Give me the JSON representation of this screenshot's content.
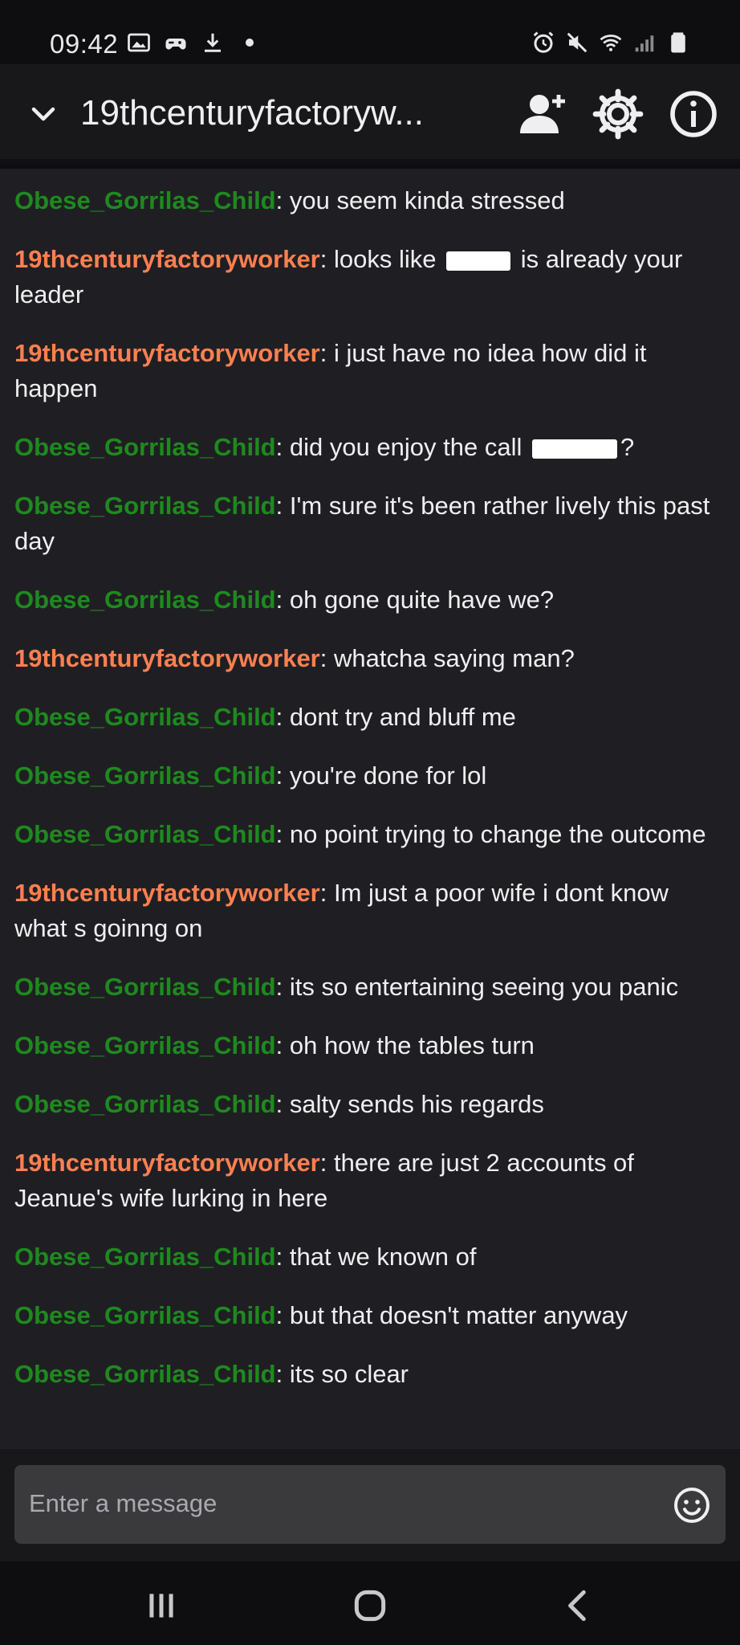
{
  "status_bar": {
    "time": "09:42",
    "left_icons": [
      "image-icon",
      "game-controller-icon",
      "download-icon",
      "dot-icon"
    ],
    "right_icons": [
      "alarm-icon",
      "mute-icon",
      "wifi-icon",
      "signal-icon",
      "battery-icon"
    ]
  },
  "header": {
    "channel_name": "19thcenturyfactoryw...",
    "buttons": [
      "add-user-icon",
      "gear-icon",
      "info-icon"
    ]
  },
  "colors": {
    "user_green": "#1e8a1e",
    "user_orange": "#ff7f50",
    "background": "#1f1f23"
  },
  "messages": [
    {
      "user": "Obese_Gorrilas_Child",
      "text": ": you seem kinda stressed"
    },
    {
      "user": "19thcenturyfactoryworker",
      "text_before": ": looks like ",
      "text_after": " is already your leader",
      "redacted": true
    },
    {
      "user": "19thcenturyfactoryworker",
      "text": ": i just have no idea how did it happen"
    },
    {
      "user": "Obese_Gorrilas_Child",
      "text_before": ": did you enjoy the call ",
      "text_after": "?",
      "redacted": true
    },
    {
      "user": "Obese_Gorrilas_Child",
      "text": ": I'm sure it's been rather lively this past day"
    },
    {
      "user": "Obese_Gorrilas_Child",
      "text": ": oh gone quite have we?"
    },
    {
      "user": "19thcenturyfactoryworker",
      "text": ": whatcha saying man?"
    },
    {
      "user": "Obese_Gorrilas_Child",
      "text": ": dont try and bluff me"
    },
    {
      "user": "Obese_Gorrilas_Child",
      "text": ": you're done for lol"
    },
    {
      "user": "Obese_Gorrilas_Child",
      "text": ": no point trying to change the outcome"
    },
    {
      "user": "19thcenturyfactoryworker",
      "text": ": Im just a poor wife i dont know what s goinng on"
    },
    {
      "user": "Obese_Gorrilas_Child",
      "text": ": its so entertaining seeing you panic"
    },
    {
      "user": "Obese_Gorrilas_Child",
      "text": ": oh how the tables turn"
    },
    {
      "user": "Obese_Gorrilas_Child",
      "text": ": salty sends his regards"
    },
    {
      "user": "19thcenturyfactoryworker",
      "text": ": there are just 2 accounts of Jeanue's wife lurking in here"
    },
    {
      "user": "Obese_Gorrilas_Child",
      "text": ": that we known of"
    },
    {
      "user": "Obese_Gorrilas_Child",
      "text": ": but that doesn't matter anyway"
    },
    {
      "user": "Obese_Gorrilas_Child",
      "text": ": its so clear"
    }
  ],
  "composer": {
    "placeholder": "Enter a message",
    "emoji_icon": "emoji-icon"
  },
  "nav_bar": {
    "buttons": [
      "recent-apps-icon",
      "home-icon",
      "back-icon"
    ]
  }
}
